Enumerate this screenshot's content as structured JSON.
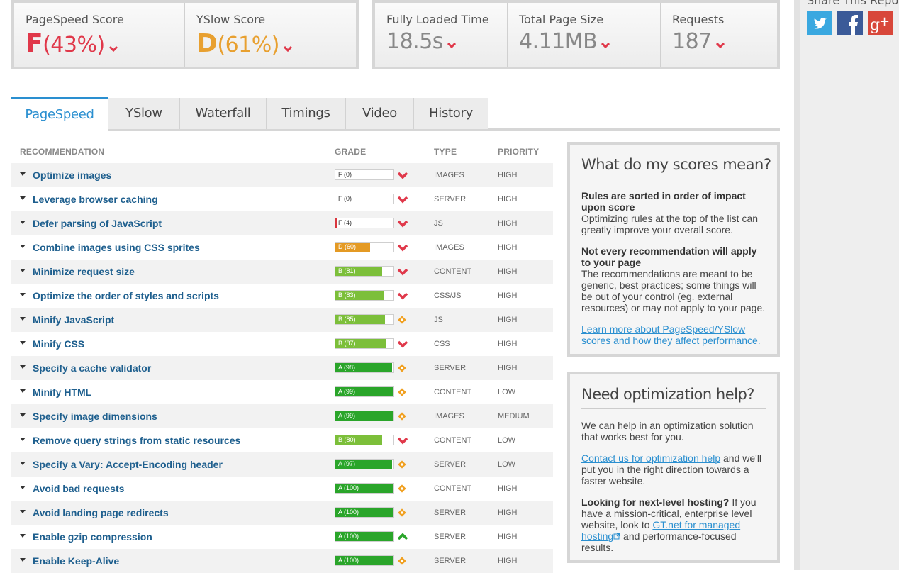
{
  "share": {
    "title": "Share This Report",
    "icons": [
      "twitter-icon",
      "facebook-icon",
      "google-plus-icon"
    ]
  },
  "scores": {
    "pagespeed": {
      "label": "PageSpeed Score",
      "grade": "F",
      "percent": "(43%)",
      "color": "#e0384a"
    },
    "yslow": {
      "label": "YSlow Score",
      "grade": "D",
      "percent": "(61%)",
      "color": "#e8a030"
    }
  },
  "metrics": [
    {
      "label": "Fully Loaded Time",
      "value": "18.5s"
    },
    {
      "label": "Total Page Size",
      "value": "4.11MB"
    },
    {
      "label": "Requests",
      "value": "187"
    }
  ],
  "tabs": [
    "PageSpeed",
    "YSlow",
    "Waterfall",
    "Timings",
    "Video",
    "History"
  ],
  "table": {
    "headers": {
      "recommendation": "RECOMMENDATION",
      "grade": "GRADE",
      "type": "TYPE",
      "priority": "PRIORITY"
    },
    "rows": [
      {
        "name": "Optimize images",
        "grade": "F (0)",
        "score": 0,
        "trend": "down",
        "type": "IMAGES",
        "priority": "HIGH"
      },
      {
        "name": "Leverage browser caching",
        "grade": "F (0)",
        "score": 0,
        "trend": "down",
        "type": "SERVER",
        "priority": "HIGH"
      },
      {
        "name": "Defer parsing of JavaScript",
        "grade": "F (4)",
        "score": 4,
        "trend": "down",
        "type": "JS",
        "priority": "HIGH"
      },
      {
        "name": "Combine images using CSS sprites",
        "grade": "D (60)",
        "score": 60,
        "trend": "down",
        "type": "IMAGES",
        "priority": "HIGH"
      },
      {
        "name": "Minimize request size",
        "grade": "B (81)",
        "score": 81,
        "trend": "down",
        "type": "CONTENT",
        "priority": "HIGH"
      },
      {
        "name": "Optimize the order of styles and scripts",
        "grade": "B (83)",
        "score": 83,
        "trend": "down",
        "type": "CSS/JS",
        "priority": "HIGH"
      },
      {
        "name": "Minify JavaScript",
        "grade": "B (85)",
        "score": 85,
        "trend": "neutral",
        "type": "JS",
        "priority": "HIGH"
      },
      {
        "name": "Minify CSS",
        "grade": "B (87)",
        "score": 87,
        "trend": "down",
        "type": "CSS",
        "priority": "HIGH"
      },
      {
        "name": "Specify a cache validator",
        "grade": "A (98)",
        "score": 98,
        "trend": "neutral",
        "type": "SERVER",
        "priority": "HIGH"
      },
      {
        "name": "Minify HTML",
        "grade": "A (99)",
        "score": 99,
        "trend": "neutral",
        "type": "CONTENT",
        "priority": "LOW"
      },
      {
        "name": "Specify image dimensions",
        "grade": "A (99)",
        "score": 99,
        "trend": "neutral",
        "type": "IMAGES",
        "priority": "MEDIUM"
      },
      {
        "name": "Remove query strings from static resources",
        "grade": "B (80)",
        "score": 80,
        "trend": "down",
        "type": "CONTENT",
        "priority": "LOW"
      },
      {
        "name": "Specify a Vary: Accept-Encoding header",
        "grade": "A (97)",
        "score": 97,
        "trend": "neutral",
        "type": "SERVER",
        "priority": "LOW"
      },
      {
        "name": "Avoid bad requests",
        "grade": "A (100)",
        "score": 100,
        "trend": "neutral",
        "type": "CONTENT",
        "priority": "HIGH"
      },
      {
        "name": "Avoid landing page redirects",
        "grade": "A (100)",
        "score": 100,
        "trend": "neutral",
        "type": "SERVER",
        "priority": "HIGH"
      },
      {
        "name": "Enable gzip compression",
        "grade": "A (100)",
        "score": 100,
        "trend": "up",
        "type": "SERVER",
        "priority": "HIGH"
      },
      {
        "name": "Enable Keep-Alive",
        "grade": "A (100)",
        "score": 100,
        "trend": "neutral",
        "type": "SERVER",
        "priority": "HIGH"
      }
    ]
  },
  "grade_colors": {
    "F": "#d9363e",
    "D": "#e49a24",
    "B": "#7cbf3a",
    "A": "#2aa52a"
  },
  "panel_scores": {
    "title": "What do my scores mean?",
    "p1_bold": "Rules are sorted in order of impact upon score",
    "p1_text": "Optimizing rules at the top of the list can greatly improve your overall score.",
    "p2_bold": "Not every recommendation will apply to your page",
    "p2_text": "The recommendations are meant to be generic, best practices; some things will be out of your control (eg. external resources) or may not apply to your page.",
    "link": "Learn more about PageSpeed/YSlow scores and how they affect performance."
  },
  "panel_help": {
    "title": "Need optimization help?",
    "p1": "We can help in an optimization solution that works best for you.",
    "contact_link": "Contact us for optimization help",
    "contact_rest": " and we'll put you in the right direction towards a faster website.",
    "hosting_bold": "Looking for next-level hosting?",
    "hosting_text": " If you have a mission-critical, enterprise level website, look to ",
    "hosting_link": "GT.net for managed hosting",
    "hosting_end": " and performance-focused results."
  }
}
